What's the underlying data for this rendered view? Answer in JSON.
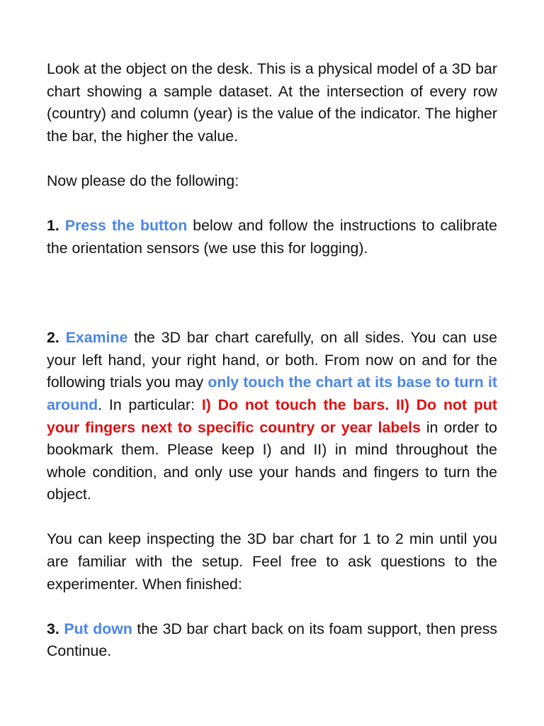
{
  "intro": {
    "text": "Look at the object on the desk. This is a physical model of a 3D bar chart showing a sample dataset. At the intersection of every row (country) and column (year) is the value of the indicator. The higher the bar, the higher the value."
  },
  "lead": {
    "text": "Now please do the following:"
  },
  "step1": {
    "number": "1.",
    "highlight": "Press the button",
    "rest": " below and follow the instructions to calibrate the orientation sensors (we use this for logging)."
  },
  "step2": {
    "number": "2.",
    "highlight": "Examine",
    "text_a": " the 3D bar chart carefully, on all sides. You can use your left hand, your right hand, or both. From now on and for the following trials you may ",
    "highlight_b": "only touch the chart at its base to turn it around",
    "text_c": ". In particular: ",
    "warning": "I) Do not touch the bars. II) Do not put your fingers next to specific country or year labels",
    "text_d": " in order to bookmark them. Please keep I) and II) in mind throughout the whole condition, and only use your hands and fingers to turn the object."
  },
  "inspect": {
    "text": "You can keep inspecting the 3D bar chart for 1 to 2 min until you are familiar with the setup. Feel free to ask questions to the experimenter. When finished:"
  },
  "step3": {
    "number": "3.",
    "highlight": "Put down",
    "rest": " the 3D bar chart back on its foam support, then press Continue."
  },
  "colors": {
    "highlight_blue": "#4a86e8",
    "warning_red": "#e01010",
    "text": "#111111",
    "background": "#ffffff"
  }
}
